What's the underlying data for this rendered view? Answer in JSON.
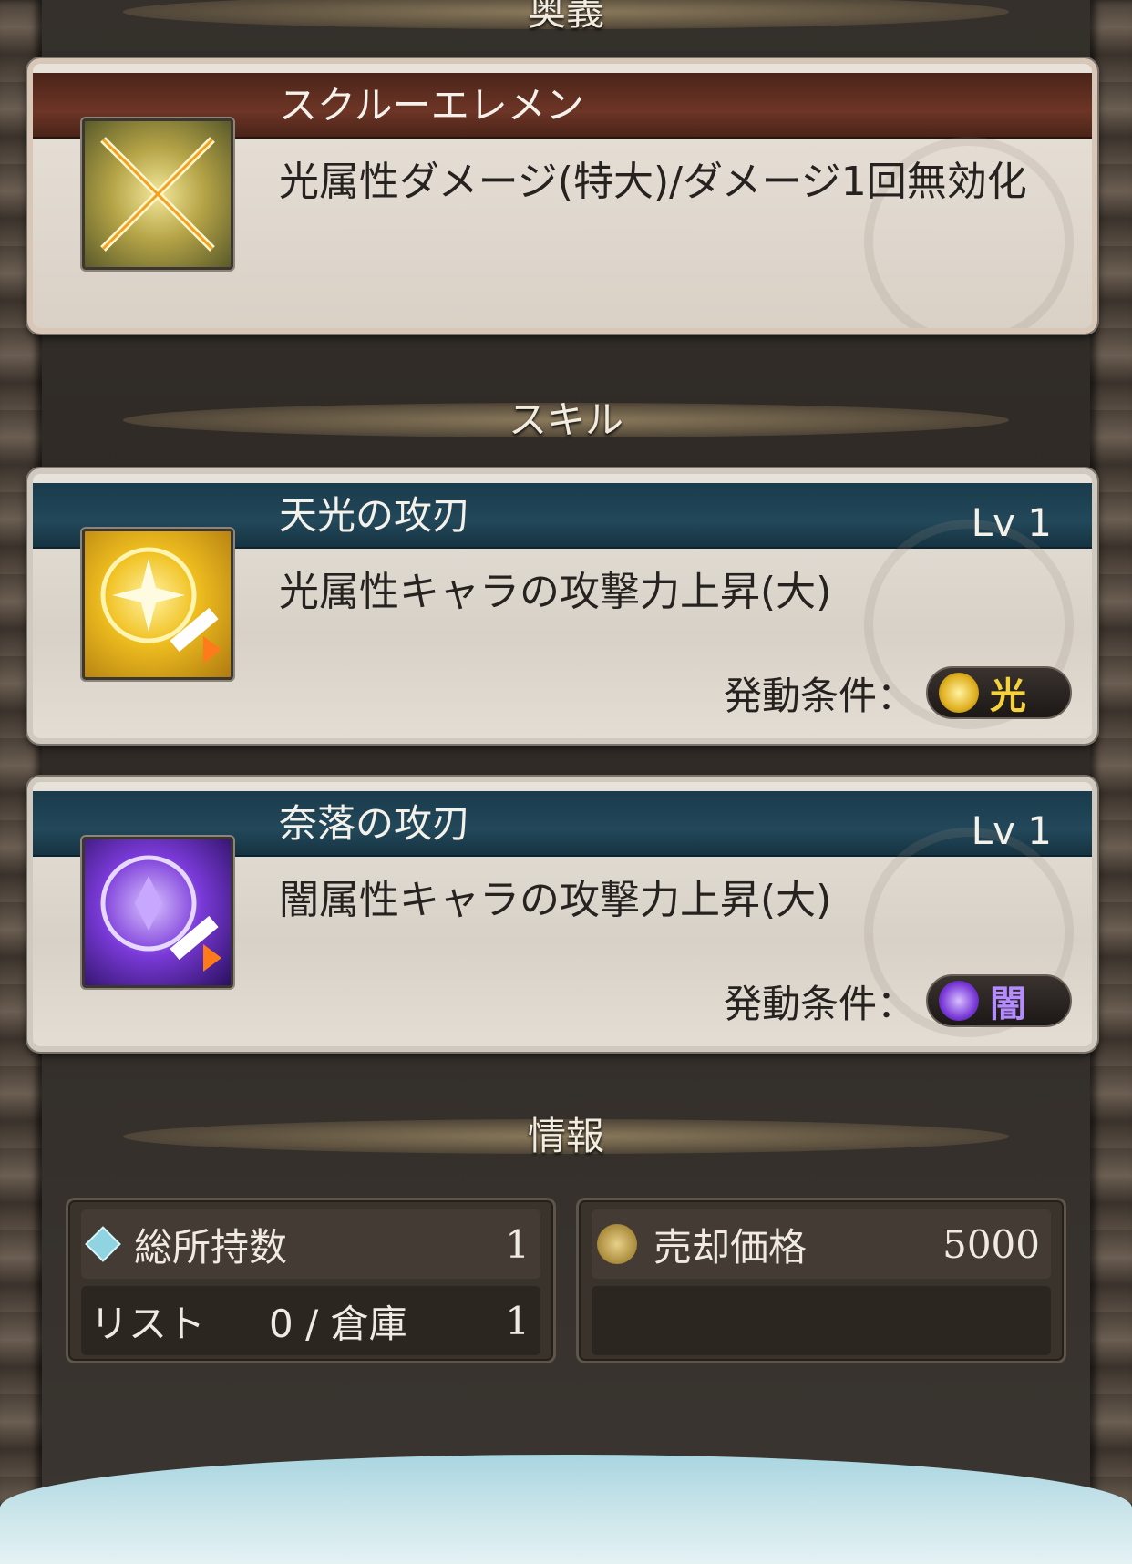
{
  "sections": {
    "ougi": "奥義",
    "skill": "スキル",
    "info": "情報"
  },
  "ougi": {
    "name": "スクルーエレメン",
    "description": "光属性ダメージ(特大)/ダメージ1回無効化",
    "icon": "crossed-swords-icon"
  },
  "skills": [
    {
      "name": "天光の攻刃",
      "level": "Lv 1",
      "description": "光属性キャラの攻撃力上昇(大)",
      "condition_label": "発動条件：",
      "condition_element": "光",
      "icon": "light-attack-up-icon",
      "element_color": "#f5d23c"
    },
    {
      "name": "奈落の攻刃",
      "level": "Lv 1",
      "description": "闇属性キャラの攻撃力上昇(大)",
      "condition_label": "発動条件：",
      "condition_element": "闇",
      "icon": "dark-attack-up-icon",
      "element_color": "#b48cff"
    }
  ],
  "info": {
    "owned_label": "総所持数",
    "owned_value": "1",
    "list_label": "リスト",
    "list_value": "0 / 倉庫",
    "storage_value": "1",
    "sell_label": "売却価格",
    "sell_value": "5000"
  }
}
